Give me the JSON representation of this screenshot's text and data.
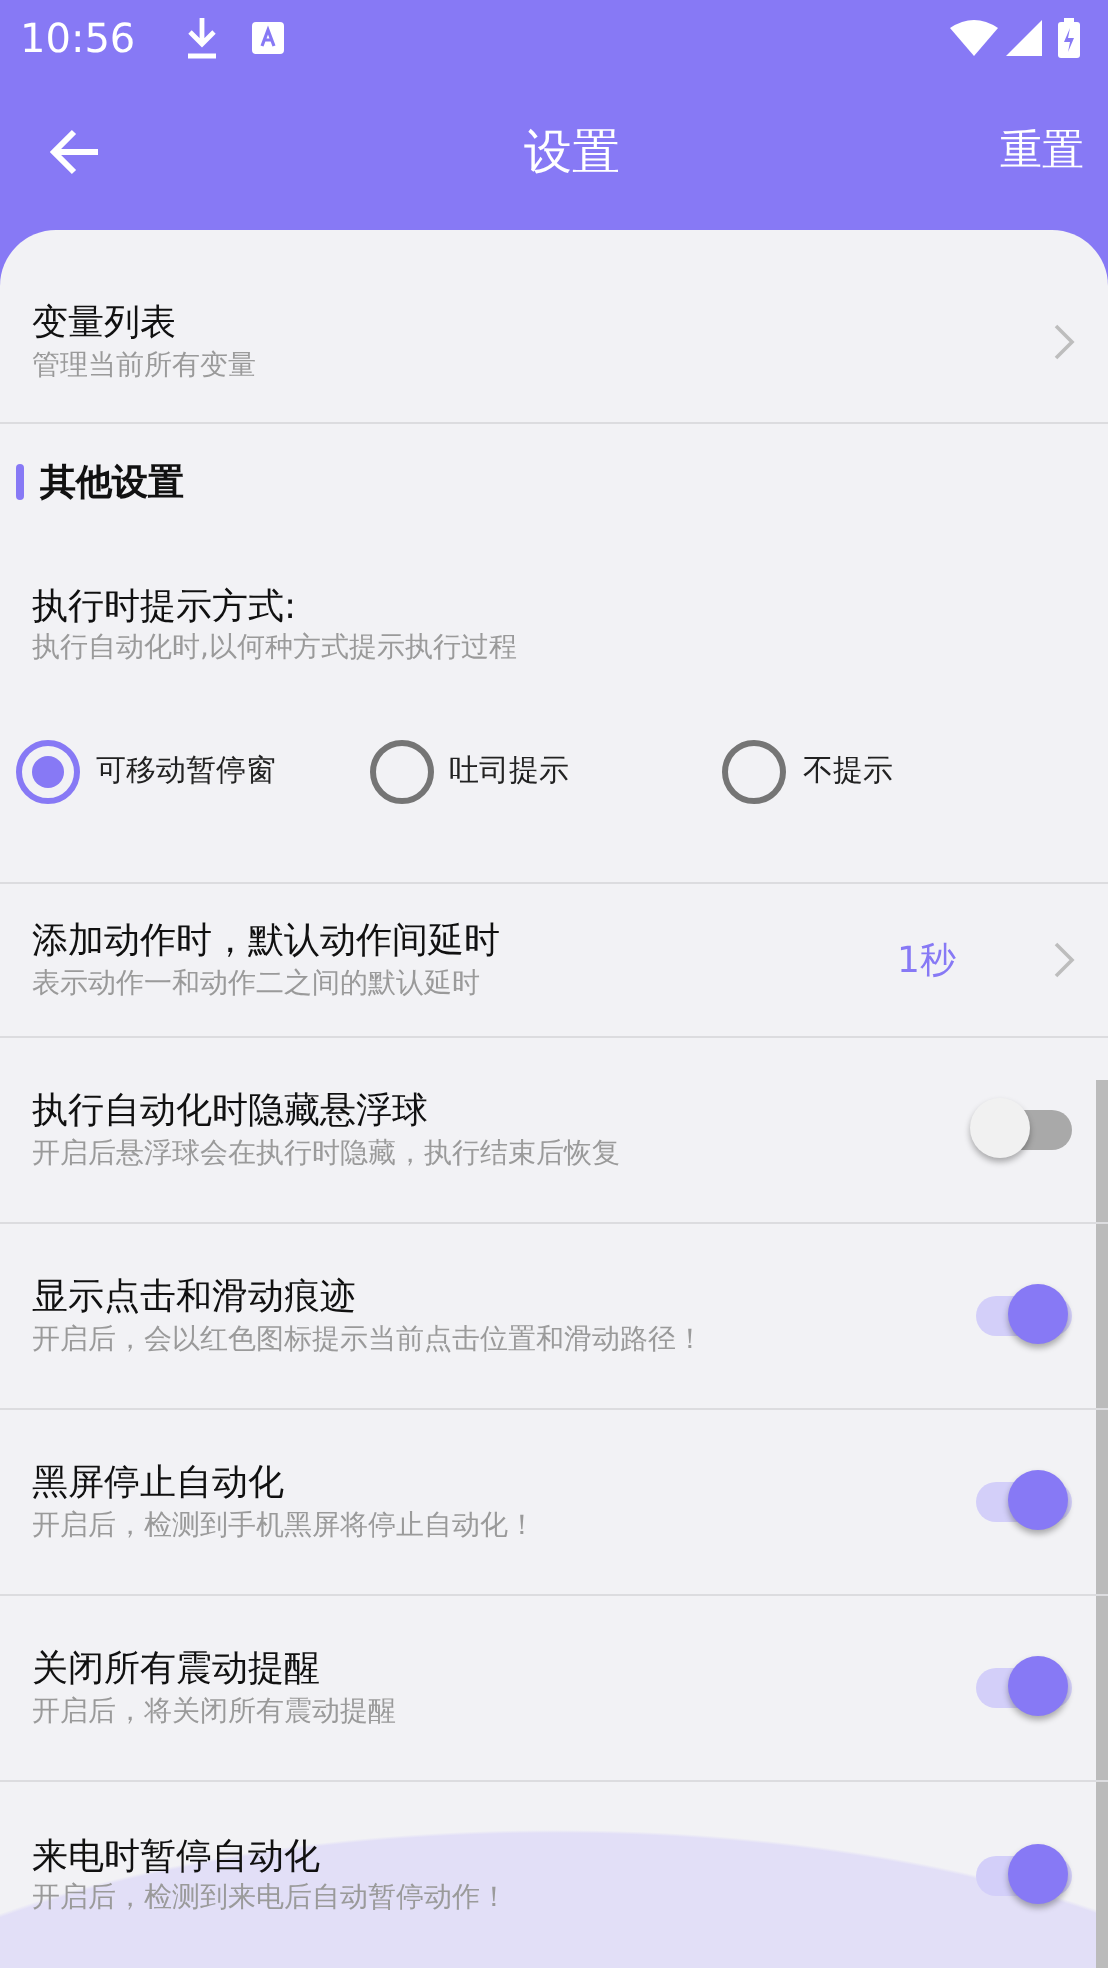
{
  "status_bar": {
    "time": "10:56"
  },
  "app_bar": {
    "title": "设置",
    "action": "重置"
  },
  "items": [
    {
      "kind": "link",
      "title": "变量列表",
      "subtitle": "管理当前所有变量"
    },
    {
      "kind": "section",
      "title": "其他设置"
    },
    {
      "kind": "radio_group",
      "title": "执行时提示方式:",
      "subtitle": "执行自动化时,以何种方式提示执行过程",
      "options": [
        {
          "label": "可移动暂停窗",
          "selected": true
        },
        {
          "label": "吐司提示",
          "selected": false
        },
        {
          "label": "不提示",
          "selected": false
        }
      ]
    },
    {
      "kind": "link",
      "title": "添加动作时，默认动作间延时",
      "subtitle": "表示动作一和动作二之间的默认延时",
      "value": "1秒"
    },
    {
      "kind": "toggle",
      "title": "执行自动化时隐藏悬浮球",
      "subtitle": "开启后悬浮球会在执行时隐藏，执行结束后恢复",
      "on": false
    },
    {
      "kind": "toggle",
      "title": "显示点击和滑动痕迹",
      "subtitle": "开启后，会以红色图标提示当前点击位置和滑动路径！",
      "on": true
    },
    {
      "kind": "toggle",
      "title": "黑屏停止自动化",
      "subtitle": "开启后，检测到手机黑屏将停止自动化！",
      "on": true
    },
    {
      "kind": "toggle",
      "title": "关闭所有震动提醒",
      "subtitle": "开启后，将关闭所有震动提醒",
      "on": true
    },
    {
      "kind": "toggle",
      "title": "来电时暂停自动化",
      "subtitle": "开启后，检测到来电后自动暂停动作！",
      "on": true
    }
  ]
}
